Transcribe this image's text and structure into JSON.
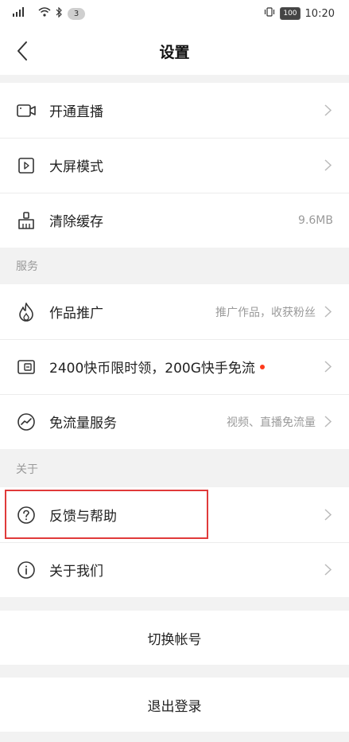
{
  "status_bar": {
    "signal_text": "⁴⁶",
    "notification_count": "3",
    "battery": "100",
    "time": "10:20"
  },
  "header": {
    "title": "设置"
  },
  "top_group": [
    {
      "label": "开通直播",
      "value": "",
      "icon": "camera-icon",
      "chevron": true
    },
    {
      "label": "大屏模式",
      "value": "",
      "icon": "play-square-icon",
      "chevron": true
    },
    {
      "label": "清除缓存",
      "value": "9.6MB",
      "icon": "broom-icon",
      "chevron": false
    }
  ],
  "services": {
    "header": "服务",
    "items": [
      {
        "label": "作品推广",
        "value": "推广作品，收获粉丝",
        "icon": "flame-icon",
        "chevron": true
      },
      {
        "label": "2400快币限时领，200G快手免流",
        "value": "",
        "icon": "card-icon",
        "chevron": true,
        "dot": true
      },
      {
        "label": "免流量服务",
        "value": "视频、直播免流量",
        "icon": "trend-icon",
        "chevron": true
      }
    ]
  },
  "about": {
    "header": "关于",
    "items": [
      {
        "label": "反馈与帮助",
        "value": "",
        "icon": "question-icon",
        "chevron": true
      },
      {
        "label": "关于我们",
        "value": "",
        "icon": "info-icon",
        "chevron": true
      }
    ]
  },
  "actions": {
    "switch_account": "切换帐号",
    "logout": "退出登录"
  },
  "colors": {
    "highlight": "#e03a3a",
    "badge_dot": "#fe3a1b",
    "secondary_text": "#9a9a9a"
  }
}
